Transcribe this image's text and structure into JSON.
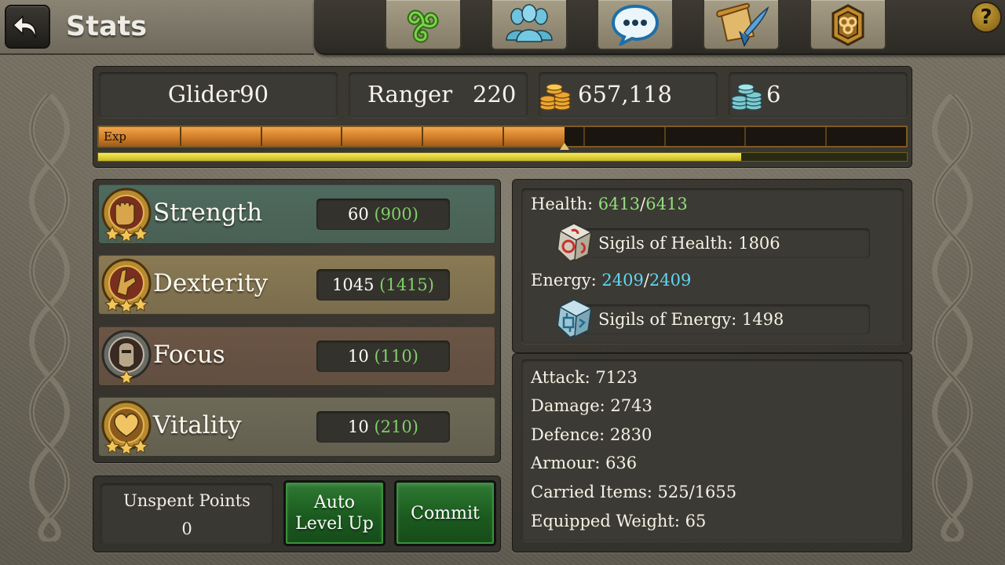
{
  "header": {
    "title": "Stats",
    "tabs": [
      {
        "icon": "triskele-icon",
        "color": "#4f9a2f"
      },
      {
        "icon": "guild-members-icon",
        "color": "#5ab9d6"
      },
      {
        "icon": "chat-bubble-icon",
        "color": "#3c9fe0"
      },
      {
        "icon": "quest-scroll-icon",
        "color": "#d79a33"
      },
      {
        "icon": "guild-banner-icon",
        "color": "#d49a2e"
      }
    ],
    "help_label": "?"
  },
  "player": {
    "name": "Glider90",
    "class_name": "Ranger",
    "level": "220",
    "gold": "657,118",
    "platinum": "6"
  },
  "experience": {
    "label": "Exp",
    "progress": 0.577,
    "segments": 10,
    "secondary_progress": 0.795
  },
  "attributes": [
    {
      "name": "Strength",
      "value": "60",
      "bonus": "(900)",
      "icon": "strength-fist-icon",
      "row_color": "#4e6a5e"
    },
    {
      "name": "Dexterity",
      "value": "1045",
      "bonus": "(1415)",
      "icon": "dexterity-gauntlet-icon",
      "row_color": "#8a7a54"
    },
    {
      "name": "Focus",
      "value": "10",
      "bonus": "(110)",
      "icon": "focus-helm-icon",
      "row_color": "#6b5545"
    },
    {
      "name": "Vitality",
      "value": "10",
      "bonus": "(210)",
      "icon": "vitality-heart-icon",
      "row_color": "#6e6a58"
    }
  ],
  "actions": {
    "unspent_label": "Unspent Points",
    "unspent_value": "0",
    "auto_level_label_1": "Auto",
    "auto_level_label_2": "Level Up",
    "commit_label": "Commit"
  },
  "vitals": {
    "health_label": "Health:",
    "health_current": "6413",
    "health_max": "6413",
    "sigils_health_label": "Sigils of Health: 1806",
    "energy_label": "Energy:",
    "energy_current": "2409",
    "energy_max": "2409",
    "sigils_energy_label": "Sigils of Energy: 1498"
  },
  "combat_stats": [
    "Attack: 7123",
    "Damage: 2743",
    "Defence: 2830",
    "Armour: 636",
    "Carried Items: 525/1655",
    "Equipped Weight: 65"
  ],
  "colors": {
    "exp_fill": "#cc7a26",
    "bonus_green": "#7fd06a",
    "health_green": "#8fe07a",
    "energy_blue": "#5fd6f2",
    "button_green": "#1b5b1f"
  }
}
